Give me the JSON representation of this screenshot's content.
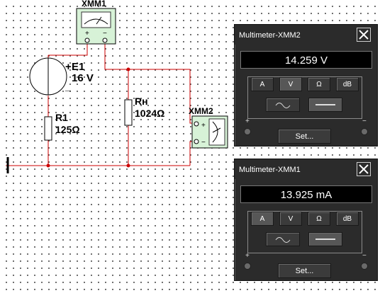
{
  "schematic": {
    "xmm1_label": "XMM1",
    "xmm2_label": "XMM2",
    "e1_name": "E1",
    "e1_value": "16 V",
    "r1_name": "R1",
    "r1_value": "125Ω",
    "rh_name": "Rн",
    "rh_value": "1024Ω"
  },
  "panel_v": {
    "title": "Multimeter-XMM2",
    "display": "14.259 V",
    "buttons": [
      "A",
      "V",
      "Ω",
      "dB"
    ],
    "active": "V",
    "set_label": "Set..."
  },
  "panel_a": {
    "title": "Multimeter-XMM1",
    "display": "13.925 mA",
    "buttons": [
      "A",
      "V",
      "Ω",
      "dB"
    ],
    "active": "A",
    "set_label": "Set..."
  },
  "colors": {
    "wire": "#cc0000",
    "meter_body": "#d7f2d7",
    "panel_bg": "#2b2b2b"
  }
}
